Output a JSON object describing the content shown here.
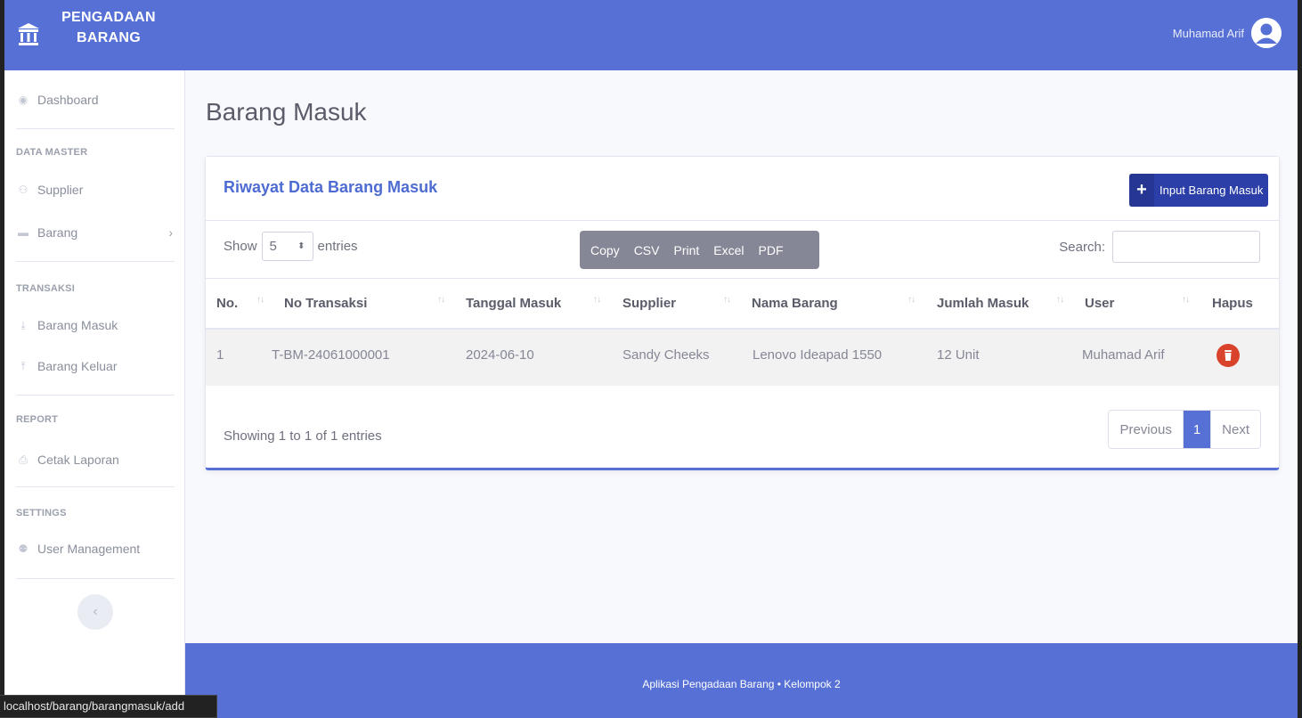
{
  "app": {
    "brand_line1": "PENGADAAN",
    "brand_line2": "BARANG",
    "user_name": "Muhamad Arif",
    "accent_color": "#5670d6"
  },
  "sidebar": {
    "dashboard": "Dashboard",
    "heading_master": "DATA MASTER",
    "supplier": "Supplier",
    "barang": "Barang",
    "heading_transaksi": "TRANSAKSI",
    "barang_masuk": "Barang Masuk",
    "barang_keluar": "Barang Keluar",
    "heading_report": "REPORT",
    "cetak_laporan": "Cetak Laporan",
    "heading_settings": "SETTINGS",
    "user_management": "User Management"
  },
  "main": {
    "page_title": "Barang Masuk",
    "card_title": "Riwayat Data Barang Masuk",
    "input_button": "Input Barang Masuk",
    "show_label": "Show",
    "entries_label": "entries",
    "page_size": "5",
    "export_buttons": [
      "Copy",
      "CSV",
      "Print",
      "Excel",
      "PDF"
    ],
    "search_label": "Search:",
    "columns": [
      "No.",
      "No Transaksi",
      "Tanggal Masuk",
      "Supplier",
      "Nama Barang",
      "Jumlah Masuk",
      "User",
      "Hapus"
    ],
    "rows": [
      {
        "no": "1",
        "no_transaksi": "T-BM-24061000001",
        "tanggal": "2024-06-10",
        "supplier": "Sandy Cheeks",
        "nama_barang": "Lenovo Ideapad 1550",
        "jumlah": "12 Unit",
        "user": "Muhamad Arif"
      }
    ],
    "info": "Showing 1 to 1 of 1 entries",
    "pager": {
      "previous": "Previous",
      "current": "1",
      "next": "Next"
    }
  },
  "footer": {
    "text": "Aplikasi Pengadaan Barang • Kelompok 2"
  },
  "statusbar": {
    "url": "localhost/barang/barangmasuk/add"
  }
}
